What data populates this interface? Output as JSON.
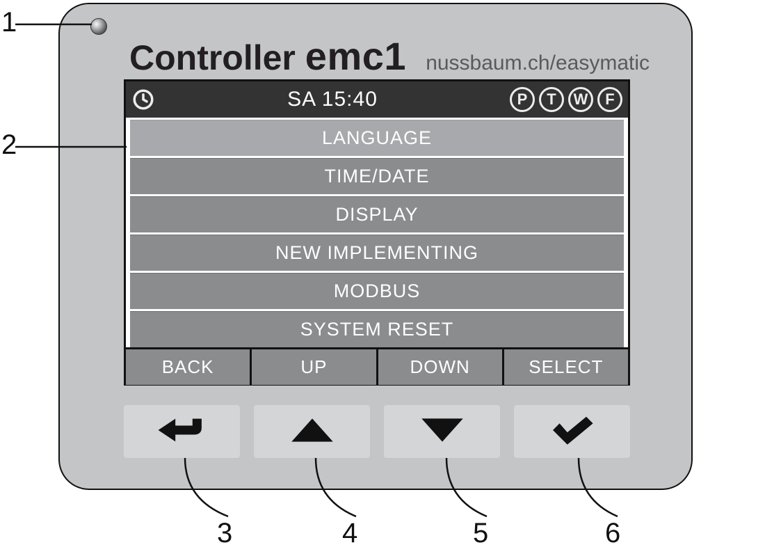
{
  "title_main": "Controller ",
  "title_emc": "emc1",
  "url_text": "nussbaum.ch/easymatic",
  "status": {
    "time": "SA 15:40",
    "indicators": [
      "P",
      "T",
      "W",
      "F"
    ]
  },
  "menu": {
    "items": [
      "LANGUAGE",
      "TIME/DATE",
      "DISPLAY",
      "NEW IMPLEMENTING",
      "MODBUS",
      "SYSTEM RESET"
    ],
    "selected_index": 0
  },
  "softkeys": [
    "BACK",
    "UP",
    "DOWN",
    "SELECT"
  ],
  "callouts": [
    "1",
    "2",
    "3",
    "4",
    "5",
    "6"
  ]
}
